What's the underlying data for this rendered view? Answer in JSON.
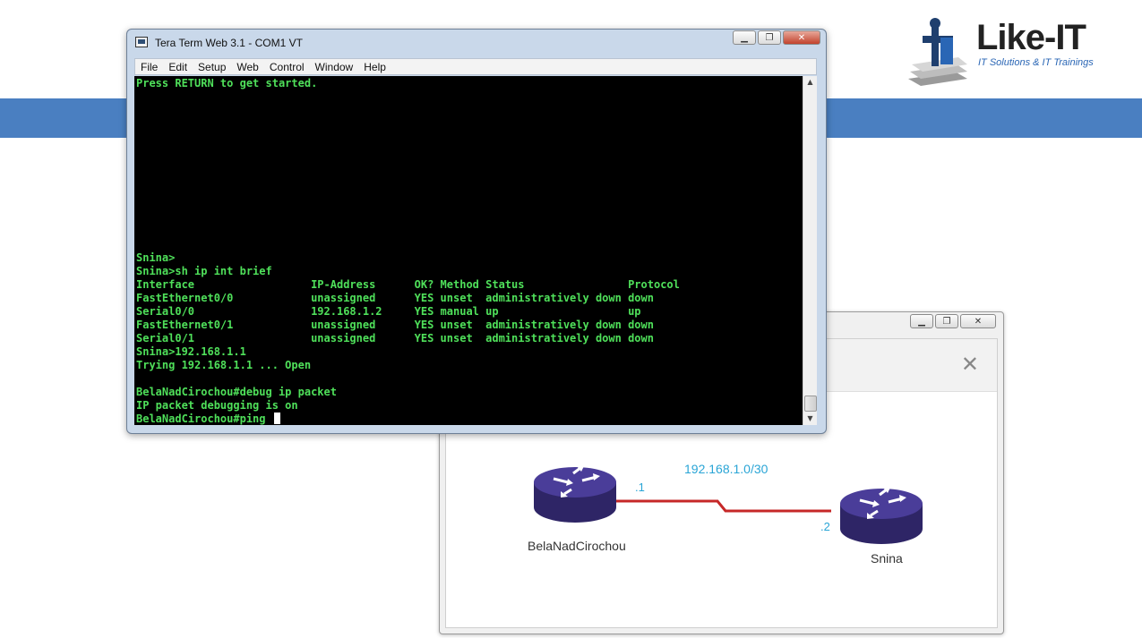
{
  "logo": {
    "name": "Like-IT",
    "tagline": "IT Solutions & IT Trainings"
  },
  "colors": {
    "banner": "#4a7fc1",
    "terminal_bg": "#000000",
    "terminal_text": "#4fe05a",
    "link_line": "#c62828",
    "router": "#3a2f7a",
    "network_label": "#2aa5d6"
  },
  "terminal": {
    "title": "Tera Term Web 3.1 - COM1 VT",
    "menu": [
      "File",
      "Edit",
      "Setup",
      "Web",
      "Control",
      "Window",
      "Help"
    ],
    "window_controls": [
      "minimize-icon",
      "maximize-icon",
      "close-icon"
    ],
    "lines": [
      "Press RETURN to get started.",
      "",
      "",
      "",
      "",
      "",
      "",
      "",
      "",
      "",
      "",
      "",
      "",
      "Snina>",
      "Snina>sh ip int brief",
      "Interface                  IP-Address      OK? Method Status                Protocol",
      "FastEthernet0/0            unassigned      YES unset  administratively down down",
      "Serial0/0                  192.168.1.2     YES manual up                    up",
      "FastEthernet0/1            unassigned      YES unset  administratively down down",
      "Serial0/1                  unassigned      YES unset  administratively down down",
      "Snina>192.168.1.1",
      "Trying 192.168.1.1 ... Open",
      "",
      "BelaNadCirochou#debug ip packet",
      "IP packet debugging is on"
    ],
    "prompt_line": "BelaNadCirochou#ping "
  },
  "diagram": {
    "window_controls": [
      "minimize-icon",
      "maximize-icon",
      "close-icon"
    ],
    "panel_close": "✕",
    "network": "192.168.1.0/30",
    "left_router": {
      "name": "BelaNadCirochou",
      "ip_suffix": ".1"
    },
    "right_router": {
      "name": "Snina",
      "ip_suffix": ".2"
    }
  }
}
